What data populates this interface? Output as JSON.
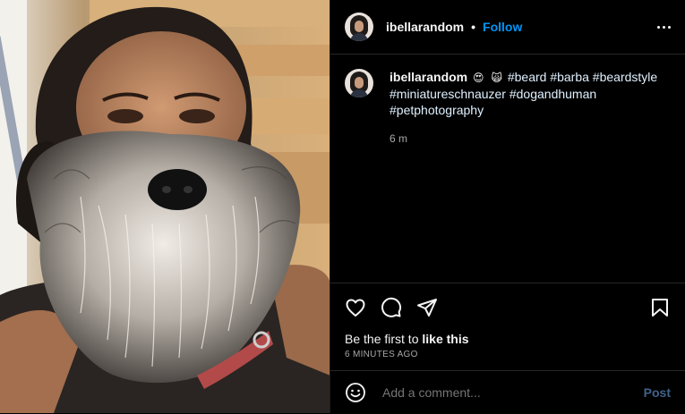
{
  "post": {
    "username": "ibellarandom",
    "follow_label": "Follow",
    "separator": "•",
    "caption_user": "ibellarandom",
    "caption_emoji_1": "😍",
    "caption_emoji_2": "🙀",
    "caption_text": "#beard #barba #beardstyle #miniatureschnauzer #dogandhuman #petphotography",
    "caption_time": "6 m",
    "likes_prefix": "Be the first to ",
    "likes_link": "like this",
    "posted_ago": "6 MINUTES AGO",
    "comment_placeholder": "Add a comment...",
    "post_button": "Post"
  },
  "icons": {
    "more": "more-options-icon",
    "like": "heart-icon",
    "comment": "comment-icon",
    "share": "share-icon",
    "save": "bookmark-icon",
    "emoji": "emoji-icon"
  },
  "colors": {
    "accent": "#0095f6",
    "background": "#000000",
    "muted": "#a8a8a8",
    "post_disabled": "#40628a"
  }
}
